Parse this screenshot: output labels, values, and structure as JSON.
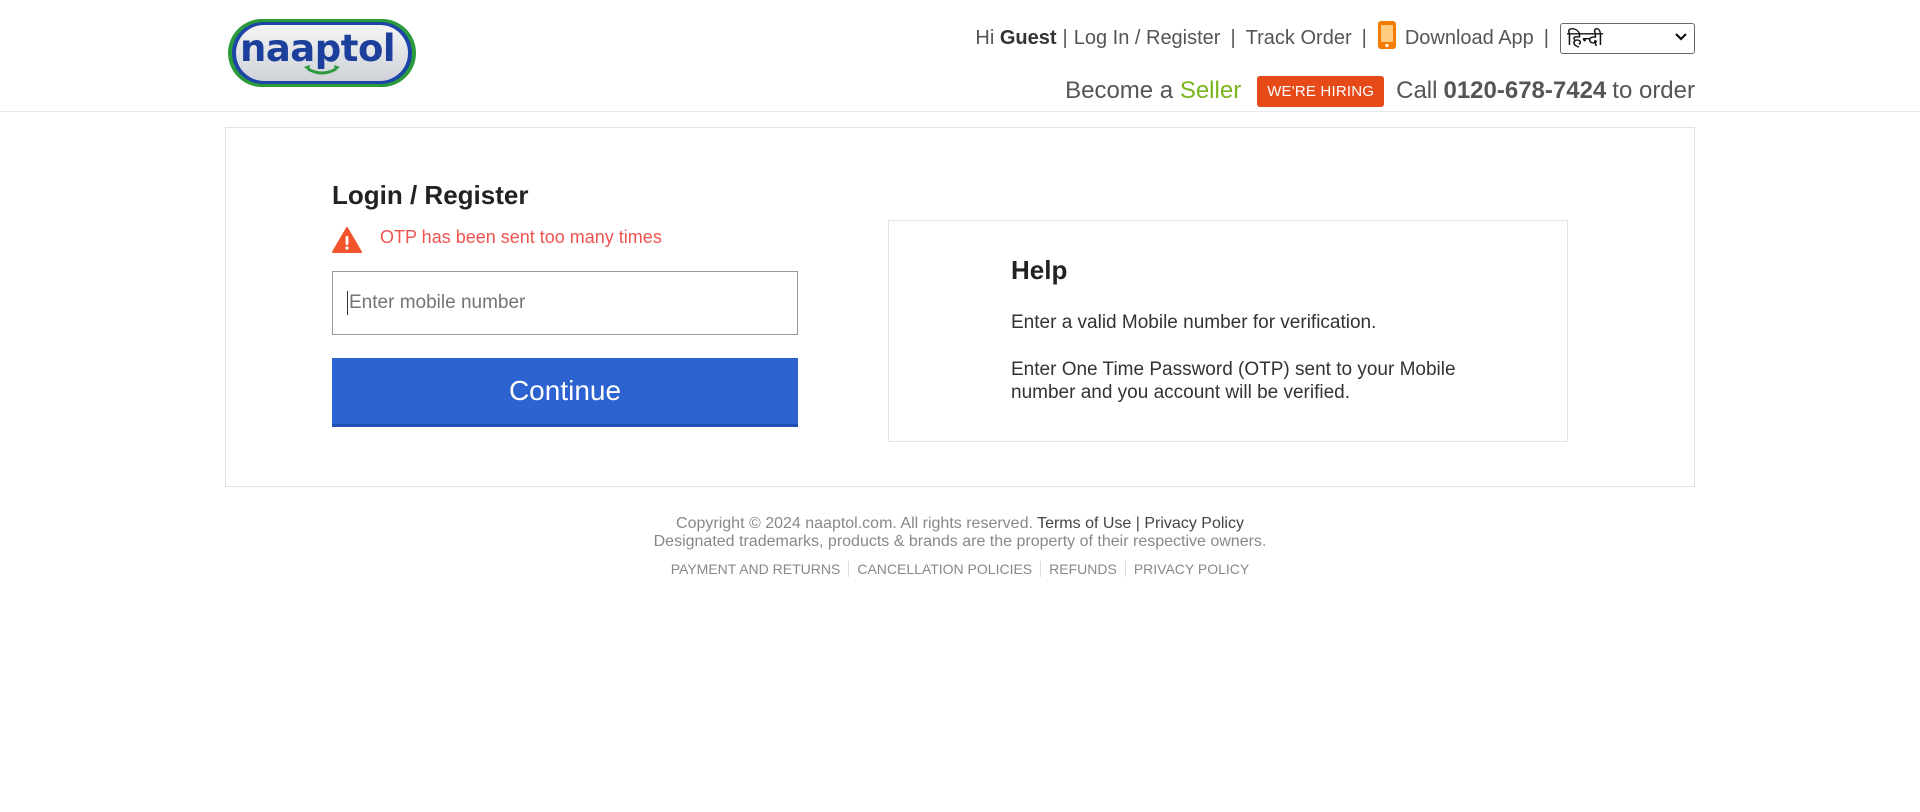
{
  "header": {
    "logo_text": "naaptol",
    "greeting": "Hi",
    "user": "Guest",
    "login_link": "Log In / Register",
    "track_order": "Track Order",
    "download_app": "Download App",
    "language_selected": "हिन्दी",
    "become_a": "Become a",
    "seller": "Seller",
    "hiring_badge": "WE'RE HIRING",
    "call_prefix": "Call",
    "phone": "0120-678-7424",
    "call_suffix": "to order"
  },
  "login": {
    "title": "Login / Register",
    "error_message": "OTP has been sent too many times",
    "mobile_placeholder": "Enter mobile number",
    "continue_label": "Continue"
  },
  "help": {
    "title": "Help",
    "para1": "Enter a valid Mobile number for verification.",
    "para2": "Enter One Time Password (OTP) sent to your Mobile number and you account will be verified."
  },
  "footer": {
    "copyright": "Copyright © 2024 naaptol.com. All rights reserved.",
    "terms": "Terms of Use",
    "privacy": "Privacy Policy",
    "trademarks": "Designated trademarks, products & brands are the property of their respective owners.",
    "links": [
      "PAYMENT AND RETURNS",
      "CANCELLATION POLICIES",
      "REFUNDS",
      "PRIVACY POLICY"
    ]
  },
  "colors": {
    "brand_blue": "#2d63d0",
    "seller_green": "#7ab51d",
    "hiring_orange": "#e64a19",
    "error_red": "#ef5350"
  }
}
